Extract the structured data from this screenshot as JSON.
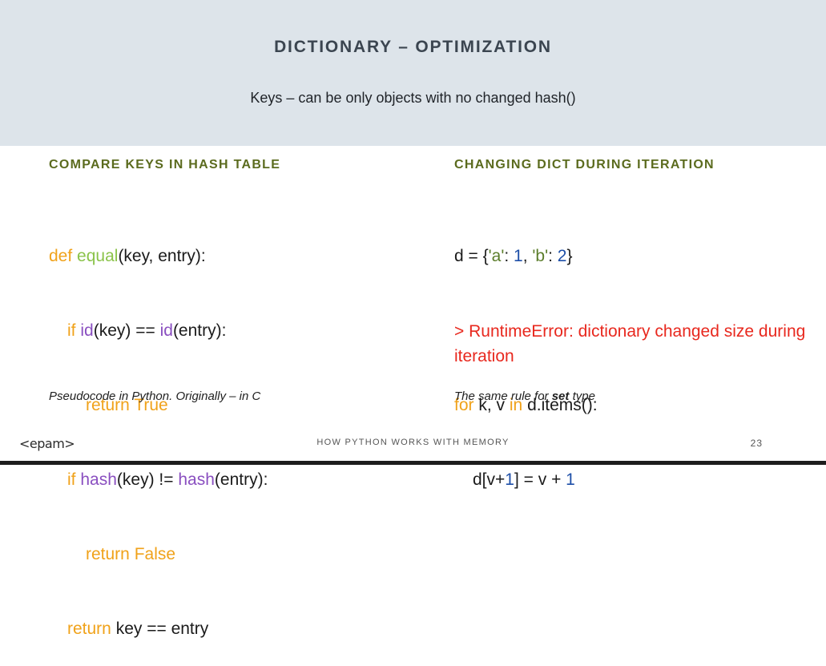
{
  "header": {
    "title": "DICTIONARY – OPTIMIZATION",
    "subtitle": "Keys – can be only objects with no changed hash()"
  },
  "left": {
    "heading": "COMPARE KEYS IN HASH TABLE",
    "code": {
      "l1": {
        "def": "def",
        "fname": "equal",
        "rest": "(key, entry):"
      },
      "l2": {
        "if": "if",
        "id1": "id",
        "mid": "(key) ==",
        "id2": "id",
        "end": "(entry):"
      },
      "l3": {
        "return": "return",
        "val": "True"
      },
      "l4": {
        "if": "if",
        "hash1": "hash",
        "mid": "(key) !=",
        "hash2": "hash",
        "end": "(entry):"
      },
      "l5": {
        "return": "return",
        "val": "False"
      },
      "l6": {
        "return": "return",
        "expr": "key == entry"
      }
    },
    "note": "Pseudocode in Python. Originally – in C"
  },
  "right": {
    "heading": "CHANGING DICT DURING ITERATION",
    "code": {
      "d_assign": "d = {",
      "key_a": "'a'",
      "colon1": ": ",
      "num1": "1",
      "comma": ", ",
      "key_b": "'b'",
      "colon2": ": ",
      "num2": "2",
      "close": "}",
      "for": "for",
      "vars": "k, v",
      "in": "in",
      "iter": "d.items():",
      "body_start": "d[v+",
      "body_num1": "1",
      "body_mid": "] = v + ",
      "body_num2": "1"
    },
    "error": "> RuntimeError: dictionary changed size during iteration",
    "note_prefix": "The same rule for",
    "note_bold": "set",
    "note_suffix": "type"
  },
  "footer": {
    "logo": "<epam>",
    "text": "HOW PYTHON WORKS WITH MEMORY",
    "page": "23"
  },
  "colors": {
    "header_bg": "#dde4ea",
    "heading": "#5b6b1e",
    "keyword": "#f0a21a",
    "function": "#8bc34a",
    "builtin": "#8a4fc0",
    "number": "#1e4fa8",
    "error": "#e8281e"
  }
}
